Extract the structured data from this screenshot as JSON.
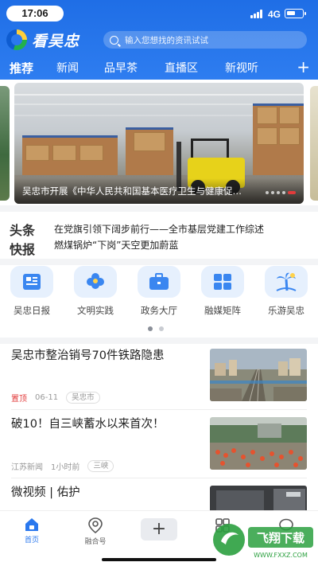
{
  "status_bar": {
    "time": "17:06",
    "network": "4G"
  },
  "header": {
    "app_name": "看吴忠",
    "search_placeholder": "输入您想找的资讯试试",
    "tabs": [
      "推荐",
      "新闻",
      "品早茶",
      "直播区",
      "新视听"
    ],
    "active_tab": 0,
    "add_icon": "plus-icon",
    "colors": {
      "brand_blue": "#2a78ee"
    }
  },
  "banner": {
    "caption": "吴忠市开展《中华人民共和国基本医疗卫生与健康促进法》",
    "total_slides": 5,
    "active_slide": 4
  },
  "headline_flash": {
    "logo_line1": "头条",
    "logo_line2": "快报",
    "items": [
      "在党旗引领下阔步前行——全市基层党建工作综述",
      "燃煤锅炉“下岗”天空更加蔚蓝"
    ]
  },
  "quick_links": [
    {
      "label": "吴忠日报",
      "icon": "newspaper-icon"
    },
    {
      "label": "文明实践",
      "icon": "flower-icon"
    },
    {
      "label": "政务大厅",
      "icon": "briefcase-icon"
    },
    {
      "label": "融媒矩阵",
      "icon": "grid-icon"
    },
    {
      "label": "乐游吴忠",
      "icon": "palm-tree-icon"
    }
  ],
  "quick_pager": {
    "pages": 2,
    "active": 0
  },
  "news": [
    {
      "title": "吴忠市整治销号70件铁路隐患",
      "pinned": "置顶",
      "date": "06-11",
      "tag": "吴忠市"
    },
    {
      "title": "破10！自三峡蓄水以来首次！",
      "source": "江苏新闻",
      "time": "1小时前",
      "tag": "三峡"
    },
    {
      "title": "微视频 | 佑护"
    }
  ],
  "bottom_nav": [
    {
      "label": "首页",
      "icon": "home-icon",
      "active": true
    },
    {
      "label": "融合号",
      "icon": "location-pin-icon",
      "active": false
    },
    {
      "label": "",
      "icon": "plus-icon",
      "active": false
    },
    {
      "label": "",
      "icon": "grid-icon",
      "active": false
    },
    {
      "label": "",
      "icon": "chat-icon",
      "active": false
    }
  ],
  "watermark": {
    "text": "飞翔下载",
    "url_text": "WWW.FXXZ.COM"
  }
}
